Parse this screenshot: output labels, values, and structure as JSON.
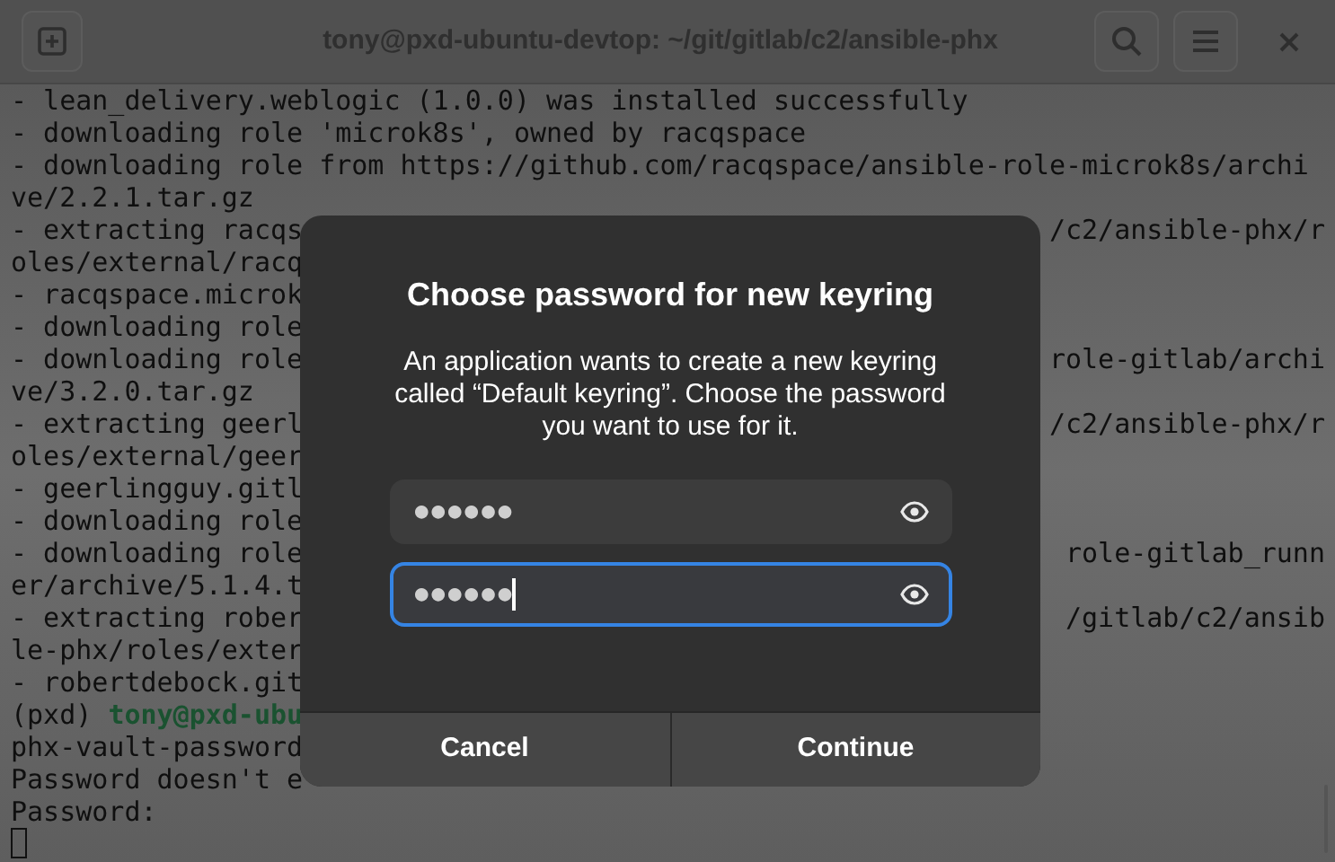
{
  "window": {
    "title": "tony@pxd-ubuntu-devtop: ~/git/gitlab/c2/ansible-phx"
  },
  "terminal": {
    "lines": [
      {
        "kind": "output",
        "text": "- lean_delivery.weblogic (1.0.0) was installed successfully"
      },
      {
        "kind": "output",
        "text": "- downloading role 'microk8s', owned by racqspace"
      },
      {
        "kind": "output",
        "text": "- downloading role from https://github.com/racqspace/ansible-role-microk8s/archi"
      },
      {
        "kind": "output",
        "text": "ve/2.2.1.tar.gz"
      },
      {
        "kind": "output",
        "text": "- extracting racqs",
        "right": "/c2/ansible-phx/r"
      },
      {
        "kind": "output",
        "text": "oles/external/racq"
      },
      {
        "kind": "output",
        "text": "- racqspace.microk"
      },
      {
        "kind": "output",
        "text": "- downloading role"
      },
      {
        "kind": "output",
        "text": "- downloading role",
        "right": "role-gitlab/archi"
      },
      {
        "kind": "output",
        "text": "ve/3.2.0.tar.gz"
      },
      {
        "kind": "output",
        "text": "- extracting geerl",
        "right": "/c2/ansible-phx/r"
      },
      {
        "kind": "output",
        "text": "oles/external/geer"
      },
      {
        "kind": "output",
        "text": "- geerlingguy.gitl"
      },
      {
        "kind": "output",
        "text": "- downloading role"
      },
      {
        "kind": "output",
        "text": "- downloading role",
        "right": "role-gitlab_runn"
      },
      {
        "kind": "output",
        "text": "er/archive/5.1.4.t"
      },
      {
        "kind": "output",
        "text": "- extracting rober",
        "right": "/gitlab/c2/ansib"
      },
      {
        "kind": "output",
        "text": "le-phx/roles/exter"
      },
      {
        "kind": "output",
        "text": "- robertdebock.git"
      },
      {
        "kind": "prompt",
        "text": "(pxd) ",
        "user": "tony@pxd-ubu"
      },
      {
        "kind": "output",
        "text": "phx-vault-password"
      },
      {
        "kind": "output",
        "text": "Password doesn't e"
      },
      {
        "kind": "output",
        "text": "Password:"
      },
      {
        "kind": "cursor"
      }
    ]
  },
  "dialog": {
    "title": "Choose password for new keyring",
    "message": "An application wants to create a new keyring called “Default keyring”. Choose the password you want to use for it.",
    "fields": [
      {
        "value": "●●●●●●",
        "focused": false
      },
      {
        "value": "●●●●●●",
        "focused": true
      }
    ],
    "buttons": [
      "Cancel",
      "Continue"
    ]
  }
}
